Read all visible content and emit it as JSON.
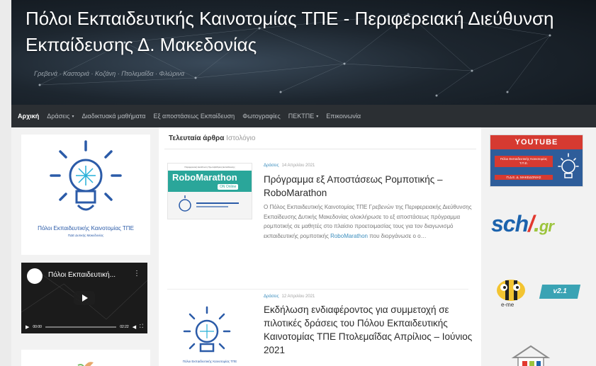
{
  "header": {
    "title": "Πόλοι Εκπαιδευτικής Καινοτομίας ΤΠΕ - Περιφερειακή Διεύθυνση Εκπαίδευσης Δ. Μακεδονίας",
    "description": "Γρεβενά · Καστοριά · Κοζάνη · Πτολεμαΐδα · Φλώρινα"
  },
  "nav": {
    "items": [
      {
        "label": "Αρχική",
        "active": true,
        "caret": false
      },
      {
        "label": "Δράσεις",
        "active": false,
        "caret": true
      },
      {
        "label": "Διαδικτυακά μαθήματα",
        "active": false,
        "caret": false
      },
      {
        "label": "Εξ αποστάσεως Εκπαίδευση",
        "active": false,
        "caret": false
      },
      {
        "label": "Φωτογραφίες",
        "active": false,
        "caret": false
      },
      {
        "label": "ΠΕΚΤΠΕ",
        "active": false,
        "caret": true
      },
      {
        "label": "Επικοινωνία",
        "active": false,
        "caret": false
      }
    ],
    "caret_glyph": "▾"
  },
  "sidebar_left": {
    "logo_text": "Πόλοι Εκπαιδευτικής Καινοτομίας ΤΠΕ",
    "logo_sub": "ΠΔΕ Δυτικής Μακεδονίας",
    "video": {
      "title": "Πόλοι Εκπαιδευτική...",
      "more_glyph": "⋮",
      "time_current": "00:00",
      "time_total": "02:22"
    }
  },
  "main": {
    "heading_bold": "Τελευταία άρθρα",
    "heading_light": "Ιστολόγιο",
    "posts": [
      {
        "category": "Δράσεις",
        "date": "14 Απριλίου 2021",
        "title": "Πρόγραμμα εξ Αποστάσεως Ρομποτικής – RoboMarathon",
        "excerpt_before": "Ο Πόλος Εκπαιδευτικής Καινοτομίας ΤΠΕ Γρεβενών της Περιφερειακής Διεύθυνσης Εκπαίδευσης Δυτικής Μακεδονίας ολοκλήρωσε το εξ αποστάσεως πρόγραμμα ρομποτικής σε μαθητές στο πλαίσιο προετοιμασίας τους για τον διαγωνισμό εκπαιδευτικής ρομποτικής ",
        "excerpt_highlight": "RoboMarathon",
        "excerpt_after": " που διοργάνωσε ο ο…",
        "thumb_top": "Περιφερειακή Διεύθυνση Πρωτοβάθμιας Εκπαίδευσης",
        "thumb_name": "RoboMarathon",
        "thumb_badge": "ΟΝ Online"
      },
      {
        "category": "Δράσεις",
        "date": "12 Απριλίου 2021",
        "title": "Εκδήλωση ενδιαφέροντος για συμμετοχή σε πιλοτικές δράσεις του Πόλου Εκπαιδευτικής Καινοτομίας ΤΠΕ Πτολεμαΐδας Απρίλιος – Ιούνιος 2021",
        "thumb_caption": "Πόλοι Εκπαιδευτικής Καινοτομίας ΤΠΕ"
      }
    ]
  },
  "sidebar_right": {
    "youtube_label": "YOUTUBE",
    "youtube_text": "Πόλοι Εκπαιδευτικής Καινοτομίας Τ.Π.Ε.",
    "youtube_sub": "Π.Δ.Ε. Δ. ΜΑΚΕΔΟΝΙΑΣ",
    "sch_main": "sch",
    "sch_dot": ".",
    "sch_slash": "/",
    "sch_gr": "gr",
    "eme_label": "e-me",
    "eme_version": "v2.1"
  },
  "colors": {
    "nav_bg": "#2b2f33",
    "accent_link": "#3b8dbd",
    "logo_blue": "#2b5ba8",
    "youtube_red": "#d63a31",
    "robomarathon_teal": "#2aa69a"
  }
}
